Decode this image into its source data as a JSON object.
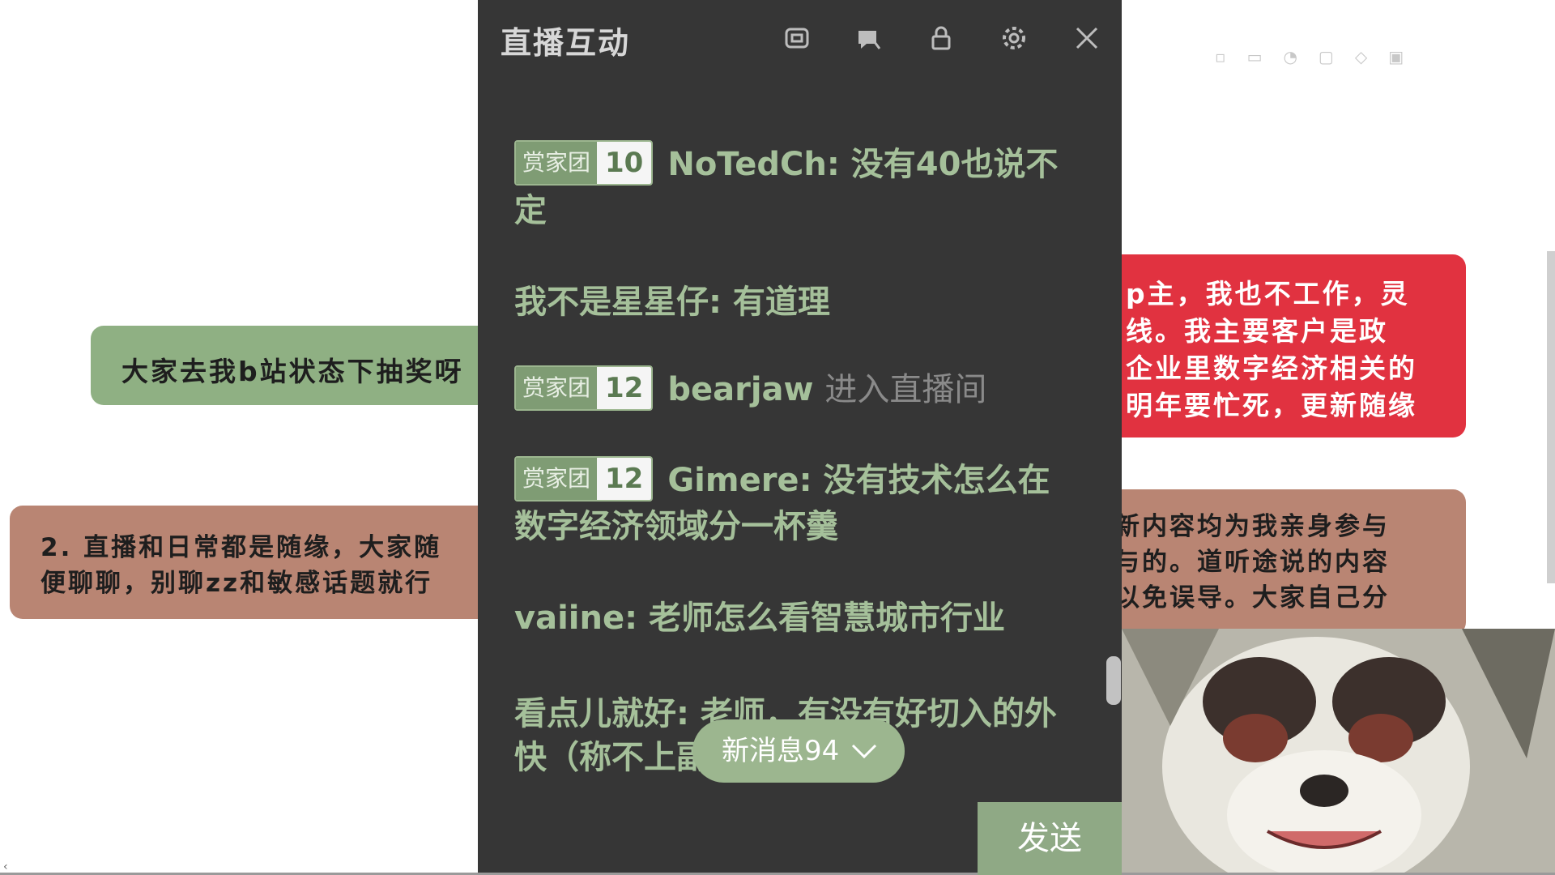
{
  "banners": {
    "green": "大家去我b站状态下抽奖呀",
    "brown_left_line1": "2. 直播和日常都是随缘，大家随",
    "brown_left_line2": "便聊聊，别聊zz和敏感话题就行",
    "red_line1": "p主，我也不工作，灵",
    "red_line2": "线。我主要客户是政",
    "red_line3": "企业里数字经济相关的",
    "red_line4": "明年要忙死，更新随缘",
    "brown_right_line1": "新内容均为我亲身参与",
    "brown_right_line2": "与的。道听途说的内容",
    "brown_right_line3": "以免误导。大家自己分"
  },
  "panel": {
    "title": "直播互动",
    "icons": [
      "window-icon",
      "chat-bubble-icon",
      "lock-icon",
      "gear-icon",
      "close-icon"
    ]
  },
  "messages": [
    {
      "badge": "赏家团",
      "level": "10",
      "user": "NoTedCh",
      "text": "没有40也说不定"
    },
    {
      "user": "我不是星星仔",
      "text": "有道理"
    },
    {
      "badge": "赏家团",
      "level": "12",
      "user": "bearjaw",
      "enter": "进入直播间"
    },
    {
      "badge": "赏家团",
      "level": "12",
      "user": "Gimere",
      "text": "没有技术怎么在数字经济领域分一杯羹"
    },
    {
      "user": "vaiine",
      "text": "老师怎么看智慧城市行业"
    },
    {
      "user": "看点儿就好",
      "text": "老师，有没有好切入的外快（称不上副"
    }
  ],
  "new_messages_label": "新消息94",
  "send_label": "发送"
}
